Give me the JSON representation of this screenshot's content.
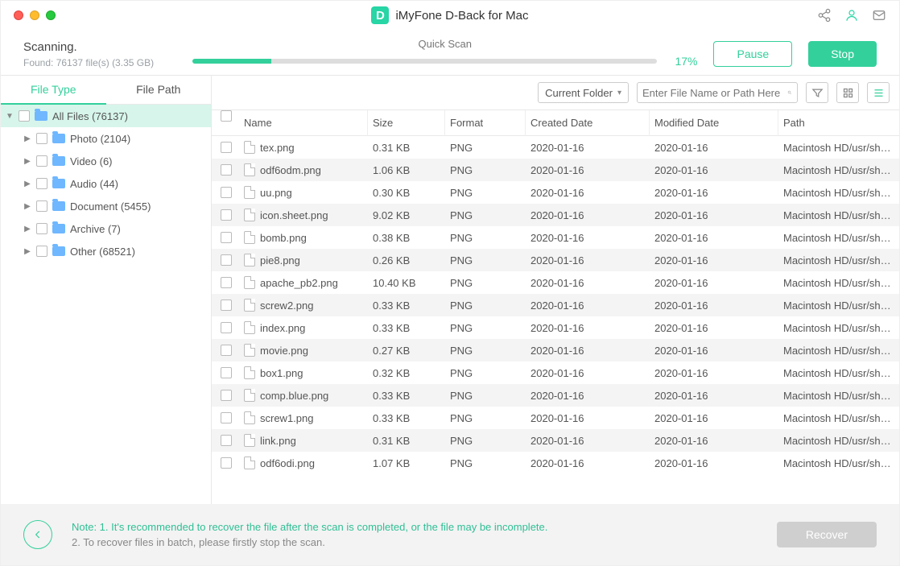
{
  "title": "iMyFone D-Back for Mac",
  "scan": {
    "mode": "Quick Scan",
    "status": "Scanning.",
    "found": "Found: 76137 file(s) (3.35 GB)",
    "percent_label": "17%",
    "percent": 17,
    "pause": "Pause",
    "stop": "Stop"
  },
  "sidebar": {
    "tabs": {
      "filetype": "File Type",
      "filepath": "File Path"
    },
    "items": [
      {
        "label": "All Files (76137)",
        "level": 0,
        "open": true
      },
      {
        "label": "Photo (2104)",
        "level": 1
      },
      {
        "label": "Video (6)",
        "level": 1
      },
      {
        "label": "Audio (44)",
        "level": 1
      },
      {
        "label": "Document (5455)",
        "level": 1
      },
      {
        "label": "Archive (7)",
        "level": 1
      },
      {
        "label": "Other (68521)",
        "level": 1
      }
    ]
  },
  "toolbar": {
    "scope": "Current Folder",
    "search_placeholder": "Enter File Name or Path Here"
  },
  "columns": {
    "name": "Name",
    "size": "Size",
    "format": "Format",
    "created": "Created Date",
    "modified": "Modified Date",
    "path": "Path"
  },
  "rows": [
    {
      "name": "tex.png",
      "size": "0.31 KB",
      "format": "PNG",
      "created": "2020-01-16",
      "modified": "2020-01-16",
      "path": "Macintosh HD/usr/share..."
    },
    {
      "name": "odf6odm.png",
      "size": "1.06 KB",
      "format": "PNG",
      "created": "2020-01-16",
      "modified": "2020-01-16",
      "path": "Macintosh HD/usr/share..."
    },
    {
      "name": "uu.png",
      "size": "0.30 KB",
      "format": "PNG",
      "created": "2020-01-16",
      "modified": "2020-01-16",
      "path": "Macintosh HD/usr/share..."
    },
    {
      "name": "icon.sheet.png",
      "size": "9.02 KB",
      "format": "PNG",
      "created": "2020-01-16",
      "modified": "2020-01-16",
      "path": "Macintosh HD/usr/share..."
    },
    {
      "name": "bomb.png",
      "size": "0.38 KB",
      "format": "PNG",
      "created": "2020-01-16",
      "modified": "2020-01-16",
      "path": "Macintosh HD/usr/share..."
    },
    {
      "name": "pie8.png",
      "size": "0.26 KB",
      "format": "PNG",
      "created": "2020-01-16",
      "modified": "2020-01-16",
      "path": "Macintosh HD/usr/share..."
    },
    {
      "name": "apache_pb2.png",
      "size": "10.40 KB",
      "format": "PNG",
      "created": "2020-01-16",
      "modified": "2020-01-16",
      "path": "Macintosh HD/usr/share..."
    },
    {
      "name": "screw2.png",
      "size": "0.33 KB",
      "format": "PNG",
      "created": "2020-01-16",
      "modified": "2020-01-16",
      "path": "Macintosh HD/usr/share..."
    },
    {
      "name": "index.png",
      "size": "0.33 KB",
      "format": "PNG",
      "created": "2020-01-16",
      "modified": "2020-01-16",
      "path": "Macintosh HD/usr/share..."
    },
    {
      "name": "movie.png",
      "size": "0.27 KB",
      "format": "PNG",
      "created": "2020-01-16",
      "modified": "2020-01-16",
      "path": "Macintosh HD/usr/share..."
    },
    {
      "name": "box1.png",
      "size": "0.32 KB",
      "format": "PNG",
      "created": "2020-01-16",
      "modified": "2020-01-16",
      "path": "Macintosh HD/usr/share..."
    },
    {
      "name": "comp.blue.png",
      "size": "0.33 KB",
      "format": "PNG",
      "created": "2020-01-16",
      "modified": "2020-01-16",
      "path": "Macintosh HD/usr/share..."
    },
    {
      "name": "screw1.png",
      "size": "0.33 KB",
      "format": "PNG",
      "created": "2020-01-16",
      "modified": "2020-01-16",
      "path": "Macintosh HD/usr/share..."
    },
    {
      "name": "link.png",
      "size": "0.31 KB",
      "format": "PNG",
      "created": "2020-01-16",
      "modified": "2020-01-16",
      "path": "Macintosh HD/usr/share..."
    },
    {
      "name": "odf6odi.png",
      "size": "1.07 KB",
      "format": "PNG",
      "created": "2020-01-16",
      "modified": "2020-01-16",
      "path": "Macintosh HD/usr/share..."
    }
  ],
  "bottom": {
    "line1": "Note: 1. It's recommended to recover the file after the scan is completed, or the file may be incomplete.",
    "line2": "2. To recover files in batch, please firstly stop the scan.",
    "recover": "Recover"
  }
}
